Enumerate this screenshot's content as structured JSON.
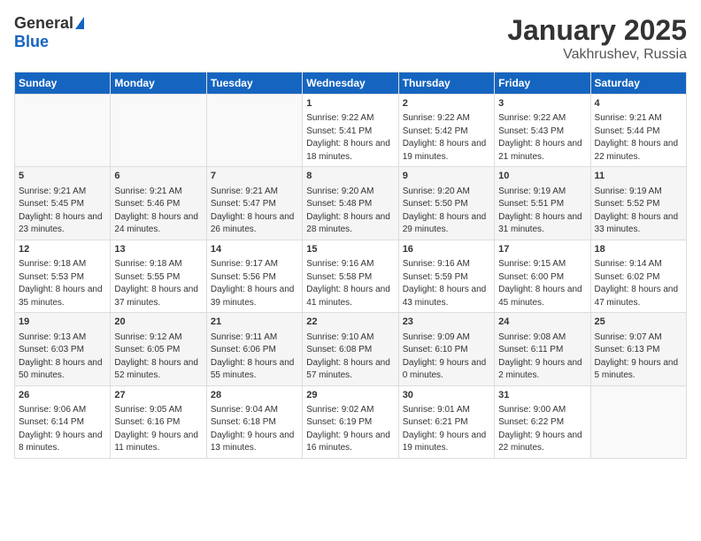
{
  "logo": {
    "general": "General",
    "blue": "Blue"
  },
  "title": "January 2025",
  "location": "Vakhrushev, Russia",
  "days_header": [
    "Sunday",
    "Monday",
    "Tuesday",
    "Wednesday",
    "Thursday",
    "Friday",
    "Saturday"
  ],
  "weeks": [
    [
      {
        "day": "",
        "sunrise": "",
        "sunset": "",
        "daylight": ""
      },
      {
        "day": "",
        "sunrise": "",
        "sunset": "",
        "daylight": ""
      },
      {
        "day": "",
        "sunrise": "",
        "sunset": "",
        "daylight": ""
      },
      {
        "day": "1",
        "sunrise": "Sunrise: 9:22 AM",
        "sunset": "Sunset: 5:41 PM",
        "daylight": "Daylight: 8 hours and 18 minutes."
      },
      {
        "day": "2",
        "sunrise": "Sunrise: 9:22 AM",
        "sunset": "Sunset: 5:42 PM",
        "daylight": "Daylight: 8 hours and 19 minutes."
      },
      {
        "day": "3",
        "sunrise": "Sunrise: 9:22 AM",
        "sunset": "Sunset: 5:43 PM",
        "daylight": "Daylight: 8 hours and 21 minutes."
      },
      {
        "day": "4",
        "sunrise": "Sunrise: 9:21 AM",
        "sunset": "Sunset: 5:44 PM",
        "daylight": "Daylight: 8 hours and 22 minutes."
      }
    ],
    [
      {
        "day": "5",
        "sunrise": "Sunrise: 9:21 AM",
        "sunset": "Sunset: 5:45 PM",
        "daylight": "Daylight: 8 hours and 23 minutes."
      },
      {
        "day": "6",
        "sunrise": "Sunrise: 9:21 AM",
        "sunset": "Sunset: 5:46 PM",
        "daylight": "Daylight: 8 hours and 24 minutes."
      },
      {
        "day": "7",
        "sunrise": "Sunrise: 9:21 AM",
        "sunset": "Sunset: 5:47 PM",
        "daylight": "Daylight: 8 hours and 26 minutes."
      },
      {
        "day": "8",
        "sunrise": "Sunrise: 9:20 AM",
        "sunset": "Sunset: 5:48 PM",
        "daylight": "Daylight: 8 hours and 28 minutes."
      },
      {
        "day": "9",
        "sunrise": "Sunrise: 9:20 AM",
        "sunset": "Sunset: 5:50 PM",
        "daylight": "Daylight: 8 hours and 29 minutes."
      },
      {
        "day": "10",
        "sunrise": "Sunrise: 9:19 AM",
        "sunset": "Sunset: 5:51 PM",
        "daylight": "Daylight: 8 hours and 31 minutes."
      },
      {
        "day": "11",
        "sunrise": "Sunrise: 9:19 AM",
        "sunset": "Sunset: 5:52 PM",
        "daylight": "Daylight: 8 hours and 33 minutes."
      }
    ],
    [
      {
        "day": "12",
        "sunrise": "Sunrise: 9:18 AM",
        "sunset": "Sunset: 5:53 PM",
        "daylight": "Daylight: 8 hours and 35 minutes."
      },
      {
        "day": "13",
        "sunrise": "Sunrise: 9:18 AM",
        "sunset": "Sunset: 5:55 PM",
        "daylight": "Daylight: 8 hours and 37 minutes."
      },
      {
        "day": "14",
        "sunrise": "Sunrise: 9:17 AM",
        "sunset": "Sunset: 5:56 PM",
        "daylight": "Daylight: 8 hours and 39 minutes."
      },
      {
        "day": "15",
        "sunrise": "Sunrise: 9:16 AM",
        "sunset": "Sunset: 5:58 PM",
        "daylight": "Daylight: 8 hours and 41 minutes."
      },
      {
        "day": "16",
        "sunrise": "Sunrise: 9:16 AM",
        "sunset": "Sunset: 5:59 PM",
        "daylight": "Daylight: 8 hours and 43 minutes."
      },
      {
        "day": "17",
        "sunrise": "Sunrise: 9:15 AM",
        "sunset": "Sunset: 6:00 PM",
        "daylight": "Daylight: 8 hours and 45 minutes."
      },
      {
        "day": "18",
        "sunrise": "Sunrise: 9:14 AM",
        "sunset": "Sunset: 6:02 PM",
        "daylight": "Daylight: 8 hours and 47 minutes."
      }
    ],
    [
      {
        "day": "19",
        "sunrise": "Sunrise: 9:13 AM",
        "sunset": "Sunset: 6:03 PM",
        "daylight": "Daylight: 8 hours and 50 minutes."
      },
      {
        "day": "20",
        "sunrise": "Sunrise: 9:12 AM",
        "sunset": "Sunset: 6:05 PM",
        "daylight": "Daylight: 8 hours and 52 minutes."
      },
      {
        "day": "21",
        "sunrise": "Sunrise: 9:11 AM",
        "sunset": "Sunset: 6:06 PM",
        "daylight": "Daylight: 8 hours and 55 minutes."
      },
      {
        "day": "22",
        "sunrise": "Sunrise: 9:10 AM",
        "sunset": "Sunset: 6:08 PM",
        "daylight": "Daylight: 8 hours and 57 minutes."
      },
      {
        "day": "23",
        "sunrise": "Sunrise: 9:09 AM",
        "sunset": "Sunset: 6:10 PM",
        "daylight": "Daylight: 9 hours and 0 minutes."
      },
      {
        "day": "24",
        "sunrise": "Sunrise: 9:08 AM",
        "sunset": "Sunset: 6:11 PM",
        "daylight": "Daylight: 9 hours and 2 minutes."
      },
      {
        "day": "25",
        "sunrise": "Sunrise: 9:07 AM",
        "sunset": "Sunset: 6:13 PM",
        "daylight": "Daylight: 9 hours and 5 minutes."
      }
    ],
    [
      {
        "day": "26",
        "sunrise": "Sunrise: 9:06 AM",
        "sunset": "Sunset: 6:14 PM",
        "daylight": "Daylight: 9 hours and 8 minutes."
      },
      {
        "day": "27",
        "sunrise": "Sunrise: 9:05 AM",
        "sunset": "Sunset: 6:16 PM",
        "daylight": "Daylight: 9 hours and 11 minutes."
      },
      {
        "day": "28",
        "sunrise": "Sunrise: 9:04 AM",
        "sunset": "Sunset: 6:18 PM",
        "daylight": "Daylight: 9 hours and 13 minutes."
      },
      {
        "day": "29",
        "sunrise": "Sunrise: 9:02 AM",
        "sunset": "Sunset: 6:19 PM",
        "daylight": "Daylight: 9 hours and 16 minutes."
      },
      {
        "day": "30",
        "sunrise": "Sunrise: 9:01 AM",
        "sunset": "Sunset: 6:21 PM",
        "daylight": "Daylight: 9 hours and 19 minutes."
      },
      {
        "day": "31",
        "sunrise": "Sunrise: 9:00 AM",
        "sunset": "Sunset: 6:22 PM",
        "daylight": "Daylight: 9 hours and 22 minutes."
      },
      {
        "day": "",
        "sunrise": "",
        "sunset": "",
        "daylight": ""
      }
    ]
  ]
}
